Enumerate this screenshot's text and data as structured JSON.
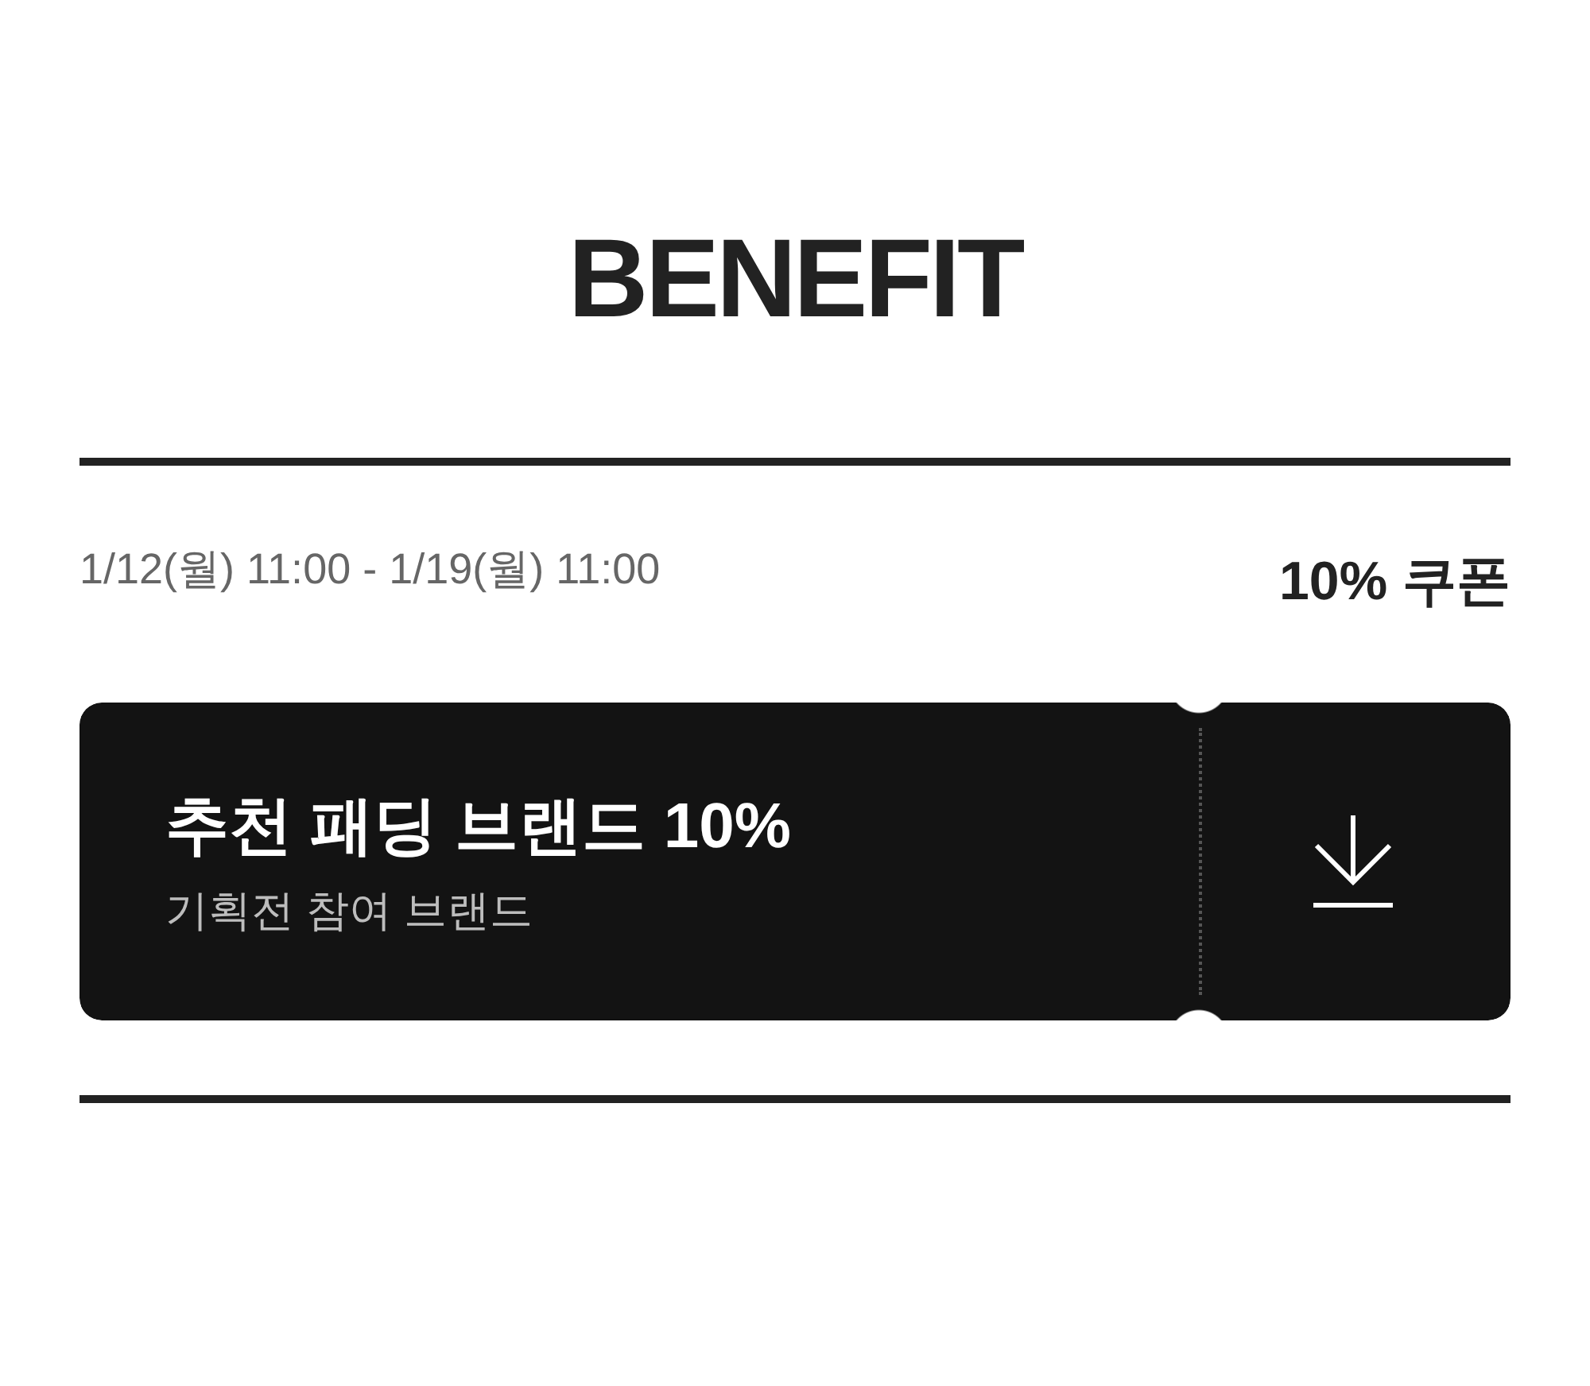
{
  "heading": {
    "title": "BENEFIT"
  },
  "coupon_period": {
    "dates": "1/12(월) 11:00 - 1/19(월) 11:00",
    "label": "10% 쿠폰"
  },
  "coupon": {
    "title": "추천 패딩 브랜드 10%",
    "subtitle": "기획전 참여 브랜드"
  }
}
